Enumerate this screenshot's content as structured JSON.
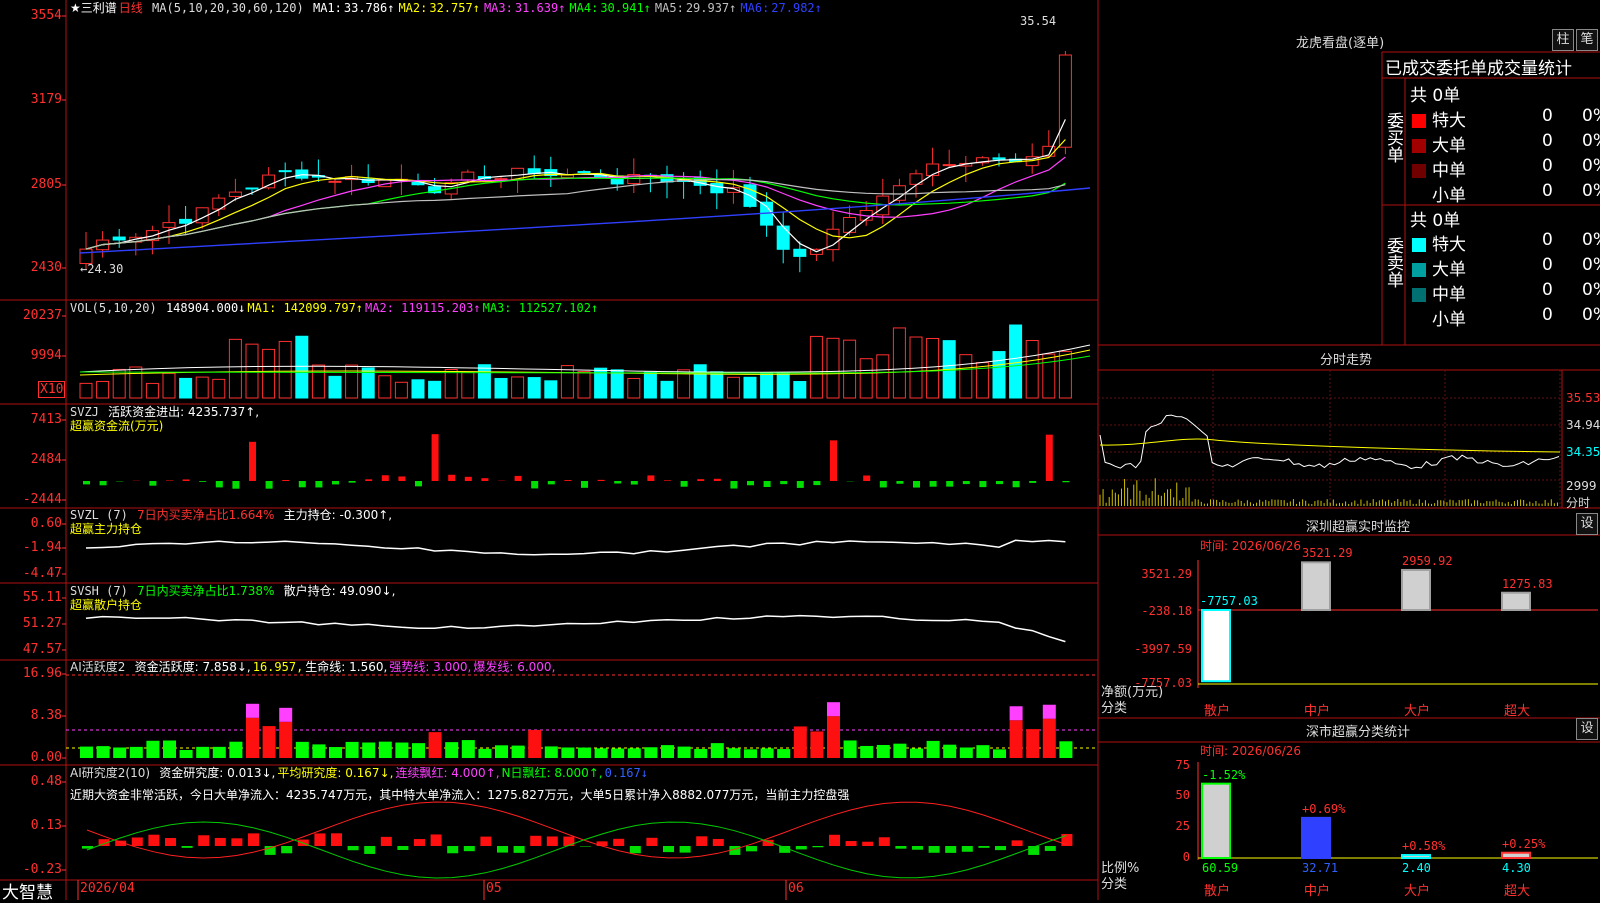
{
  "app": {
    "brand": "大智慧"
  },
  "kline": {
    "stock_name": "★三利谱",
    "period": "日线",
    "ma_title": "MA(5,10,20,30,60,120)",
    "ma_values": [
      {
        "label": "MA1:",
        "value": "33.786↑",
        "color": "#ffffff"
      },
      {
        "label": "MA2:",
        "value": "32.757↑",
        "color": "#ffff00"
      },
      {
        "label": "MA3:",
        "value": "31.639↑",
        "color": "#ff40ff"
      },
      {
        "label": "MA4:",
        "value": "30.941↑",
        "color": "#00ff00"
      },
      {
        "label": "MA5:",
        "value": "29.937↑",
        "color": "#c0c0c0"
      },
      {
        "label": "MA6:",
        "value": "27.982↑",
        "color": "#3040ff"
      }
    ],
    "y_ticks": [
      "3554",
      "3179",
      "2805",
      "2430"
    ],
    "high_label": "35.54",
    "low_label": "←24.30"
  },
  "vol": {
    "title": "VOL(5,10,20)",
    "value": "148904.000↓",
    "ma1": "MA1: 142099.797↑",
    "ma2": "MA2: 119115.203↑",
    "ma3": "MA3: 112527.102↑",
    "y_ticks": [
      "20237",
      "9994"
    ],
    "unit": "X10"
  },
  "svzj": {
    "title": "SVZJ",
    "label": "活跃资金进出: 4235.737↑,",
    "subtitle": "超赢资金流(万元)",
    "y_ticks": [
      "7413",
      "2484",
      "-2444"
    ]
  },
  "svzl": {
    "title": "SVZL (7)",
    "label1": "7日内买卖净占比1.664%",
    "label2": "主力持仓: -0.300↑,",
    "subtitle": "超赢主力持仓",
    "y_ticks": [
      "0.60",
      "-1.94",
      "-4.47"
    ]
  },
  "svsh": {
    "title": "SVSH (7)",
    "label1": "7日内买卖净占比1.738%",
    "label2": "散户持仓: 49.090↓,",
    "subtitle": "超赢散户持仓",
    "y_ticks": [
      "55.11",
      "51.27",
      "47.57"
    ]
  },
  "ai1": {
    "title": "AI活跃度2",
    "v1": "资金活跃度: 7.858↓,",
    "v2": "16.957,",
    "v3": "生命线: 1.560,",
    "v4": "强势线: 3.000,",
    "v5": "爆发线: 6.000,",
    "y_ticks": [
      "16.96",
      "8.38",
      "0.00"
    ]
  },
  "ai2": {
    "title": "AI研究度2(10)",
    "v1": "资金研究度: 0.013↓,",
    "v2": "平均研究度: 0.167↓,",
    "v3": "连续飘红: 4.000↑,",
    "v4": "N日飘红: 8.000↑,",
    "v5": "0.167↓",
    "comment": "近期大资金非常活跃，今日大单净流入：4235.747万元，其中特大单净流入：1275.827万元，大单5日累计净入8882.077万元，当前主力控盘强",
    "y_ticks": [
      "0.48",
      "0.13",
      "-0.23"
    ]
  },
  "xaxis": {
    "labels": [
      "2026/04",
      "05",
      "06"
    ]
  },
  "longhu": {
    "title": "龙虎看盘(逐单)",
    "btn1": "柱",
    "btn2": "笔",
    "tabs": "已成交委托单成交量统计",
    "buy_side": "委买单",
    "sell_side": "委卖单",
    "buy_total": "共 0单",
    "sell_total": "共 0单",
    "buy_rows": [
      {
        "name": "特大",
        "count": "0",
        "pct": "0%",
        "color": "#ff0000"
      },
      {
        "name": "大单",
        "count": "0",
        "pct": "0%",
        "color": "#a00000"
      },
      {
        "name": "中单",
        "count": "0",
        "pct": "0%",
        "color": "#700000"
      },
      {
        "name": "小单",
        "count": "0",
        "pct": "0%",
        "color": ""
      }
    ],
    "sell_rows": [
      {
        "name": "特大",
        "count": "0",
        "pct": "0%",
        "color": "#00ffff"
      },
      {
        "name": "大单",
        "count": "0",
        "pct": "0%",
        "color": "#00a0a0"
      },
      {
        "name": "中单",
        "count": "0",
        "pct": "0%",
        "color": "#007070"
      },
      {
        "name": "小单",
        "count": "0",
        "pct": "0%",
        "color": ""
      }
    ]
  },
  "fenshi": {
    "title": "分时走势",
    "y_ticks": [
      "35.53",
      "34.94",
      "34.35"
    ],
    "vol_label": "2999",
    "vol_unit": "分时"
  },
  "sz_monitor": {
    "title": "深圳超赢实时监控",
    "btn": "设",
    "time": "时间: 2026/06/26",
    "y_ticks": [
      "3521.29",
      "-238.18",
      "-3997.59",
      "-7757.03"
    ],
    "axis_label": "净额(万元)",
    "axis_label2": "分类",
    "categories": [
      "散户",
      "中户",
      "大户",
      "超大"
    ],
    "values": [
      "-7757.03",
      "3521.29",
      "2959.92",
      "1275.83"
    ]
  },
  "sz_classify": {
    "title": "深市超赢分类统计",
    "btn": "设",
    "time": "时间: 2026/06/26",
    "y_ticks": [
      "75",
      "50",
      "25",
      "0"
    ],
    "axis_label": "比例%",
    "axis_label2": "分类",
    "categories": [
      "散户",
      "中户",
      "大户",
      "超大"
    ],
    "values": [
      "60.59",
      "32.71",
      "2.40",
      "4.30"
    ],
    "changes": [
      "-1.52%",
      "+0.69%",
      "+0.58%",
      "+0.25%"
    ]
  }
}
